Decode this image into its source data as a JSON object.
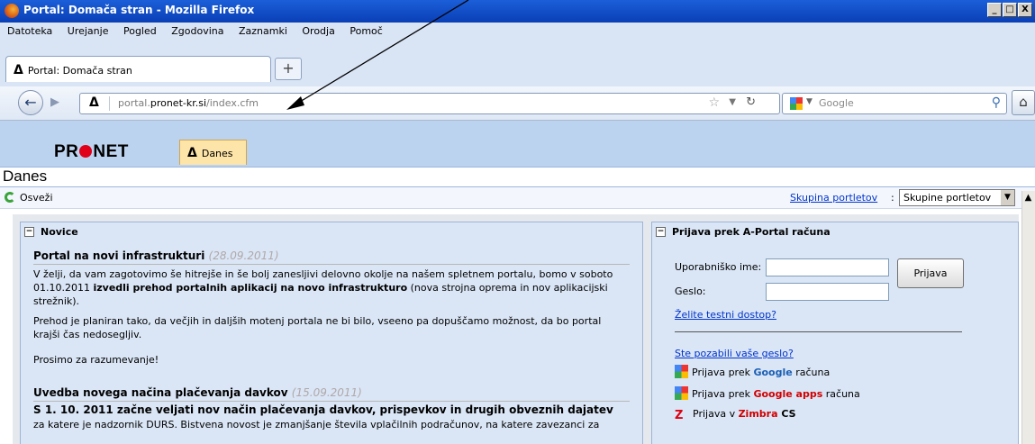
{
  "window": {
    "title": "Portal: Domača stran - Mozilla Firefox",
    "controls": [
      "_",
      "□",
      "X"
    ]
  },
  "menu": [
    "Datoteka",
    "Urejanje",
    "Pogled",
    "Zgodovina",
    "Zaznamki",
    "Orodja",
    "Pomoč"
  ],
  "tab": {
    "icon": "Δ",
    "title": "Portal: Domača stran",
    "new_tab": "+"
  },
  "nav": {
    "identity": "Δ",
    "url_prefix": "portal.",
    "url_domain": "pronet-kr.si",
    "url_path": "/index.cfm",
    "search_placeholder": "Google"
  },
  "portal": {
    "logo_pre": "PR",
    "logo_post": "NET",
    "main_tab_icon": "Δ",
    "main_tab_label": "Danes",
    "page_title": "Danes",
    "refresh_label": "Osveži",
    "portlet_group_link": "Skupina portletov",
    "portlet_group_colon": ":",
    "portlet_group_value": "Skupine portletov"
  },
  "novice": {
    "title": "Novice",
    "item1": {
      "headline": "Portal na novi infrastrukturi",
      "date": "(28.09.2011)",
      "p1_a": "V želji, da vam zagotovimo še hitrejše in še bolj zanesljivi delovno okolje na našem spletnem portalu, bomo v soboto 01.10.2011 ",
      "p1_b": "izvedli prehod portalnih aplikacij na novo infrastrukturo",
      "p1_c": " (nova strojna oprema in nov aplikacijski strežnik).",
      "p2": "Prehod je planiran tako, da večjih in daljših motenj portala ne bi bilo, vseeno pa dopuščamo možnost, da bo portal krajši čas nedosegljiv.",
      "p3": "Prosimo za razumevanje!"
    },
    "item2": {
      "headline": "Uvedba novega načina plačevanja davkov",
      "date": "(15.09.2011)",
      "p1_bold": "S 1. 10. 2011 začne veljati nov način plačevanja davkov, prispevkov in drugih obveznih dajatev",
      "p1_rest": "za katere je nadzornik DURS. Bistvena novost je zmanjšanje števila vplačilnih podračunov, na katere zavezanci za"
    }
  },
  "prijava": {
    "title": "Prijava prek A-Portal računa",
    "username_label": "Uporabniško ime:",
    "password_label": "Geslo:",
    "login_button": "Prijava",
    "test_access": "Želite testni dostop?",
    "forgot_password": "Ste pozabili vaše geslo?",
    "google_pre": "Prijava prek ",
    "google_name": "Google",
    "google_post": " računa",
    "gapps_pre": "Prijava prek ",
    "gapps_name": "Google apps",
    "gapps_post": " računa",
    "zimbra_pre": "Prijava v ",
    "zimbra_name": "Zimbra",
    "zimbra_post": " CS"
  }
}
